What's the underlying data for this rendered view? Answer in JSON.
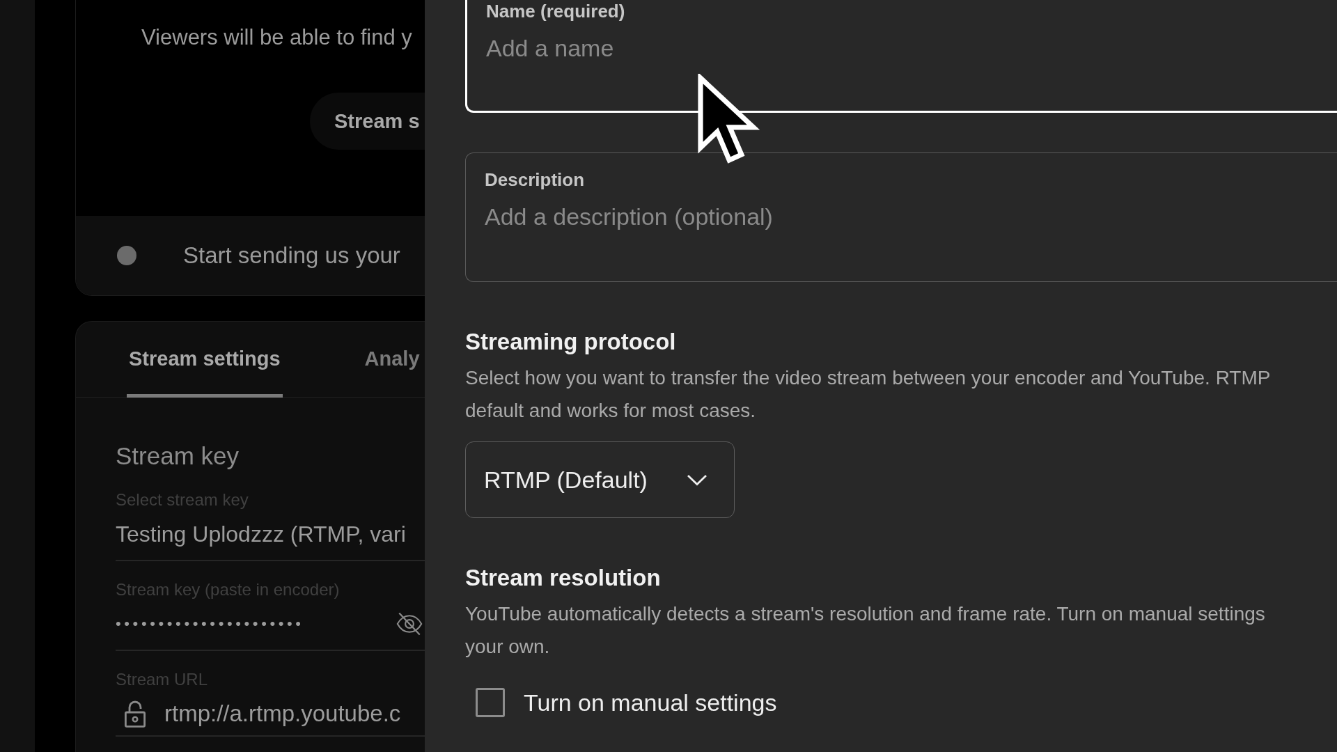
{
  "background_page": {
    "preview_card": {
      "message": "Viewers will be able to find y",
      "button": "Stream s"
    },
    "status_bar": {
      "text": "Start sending us your"
    },
    "settings_card": {
      "tabs": [
        {
          "label": "Stream settings",
          "selected": true
        },
        {
          "label": "Analy",
          "selected": false
        }
      ],
      "section_title": "Stream key",
      "fields": [
        {
          "kind": "select",
          "label": "Select stream key",
          "value": "Testing Uplodzzz (RTMP, vari"
        },
        {
          "kind": "secret",
          "label": "Stream key (paste in encoder)",
          "value": "••••••••••••••••••••••"
        },
        {
          "kind": "url",
          "label": "Stream URL",
          "value": "rtmp://a.rtmp.youtube.c"
        }
      ]
    }
  },
  "dialog": {
    "fields": [
      {
        "label": "Name (required)",
        "placeholder": "Add a name",
        "focused": true
      },
      {
        "label": "Description",
        "placeholder": "Add a description (optional)",
        "focused": false
      }
    ],
    "sections": [
      {
        "kind": "dropdown",
        "title": "Streaming protocol",
        "description_lines": [
          "Select how you want to transfer the video stream between your encoder and YouTube. RTMP",
          "default and works for most cases."
        ],
        "dropdown": {
          "value": "RTMP (Default)"
        }
      },
      {
        "kind": "checkbox",
        "title": "Stream resolution",
        "description_lines": [
          "YouTube automatically detects a stream's resolution and frame rate. Turn on manual settings",
          "your own."
        ],
        "checkbox": {
          "label": "Turn on manual settings",
          "checked": false
        }
      }
    ]
  }
}
